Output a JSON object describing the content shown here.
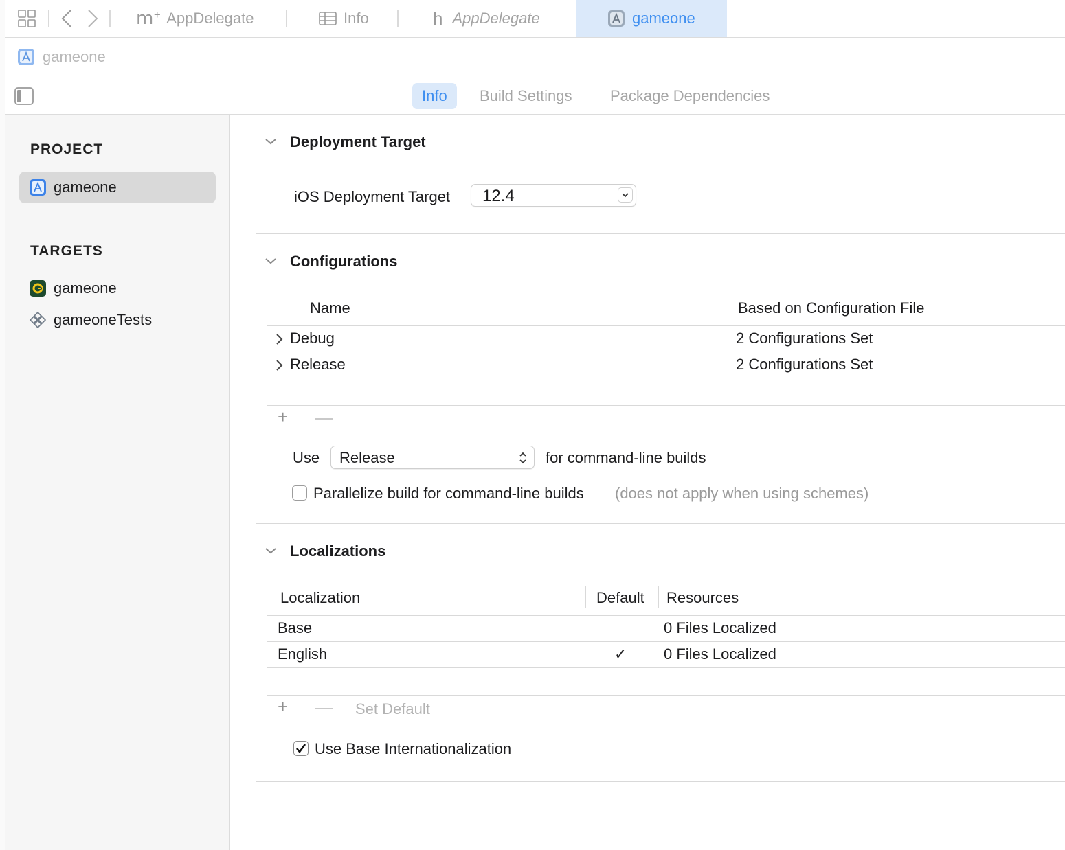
{
  "tabs": [
    {
      "label": "AppDelegate",
      "icon": "objc-file-icon"
    },
    {
      "label": "Info",
      "icon": "table-icon"
    },
    {
      "label": "AppDelegate",
      "icon": "header-file-icon"
    },
    {
      "label": "gameone",
      "icon": "xcodeproj-icon"
    }
  ],
  "breadcrumb": {
    "label": "gameone"
  },
  "segments": [
    "Info",
    "Build Settings",
    "Package Dependencies"
  ],
  "sidebar": {
    "project_header": "PROJECT",
    "project_item": "gameone",
    "targets_header": "TARGETS",
    "targets": [
      "gameone",
      "gameoneTests"
    ]
  },
  "deployment": {
    "title": "Deployment Target",
    "label": "iOS Deployment Target",
    "value": "12.4"
  },
  "configurations": {
    "title": "Configurations",
    "col_name": "Name",
    "col_file": "Based on Configuration File",
    "rows": [
      {
        "name": "Debug",
        "file": "2 Configurations Set"
      },
      {
        "name": "Release",
        "file": "2 Configurations Set"
      }
    ],
    "use_prefix": "Use",
    "use_value": "Release",
    "use_suffix": "for command-line builds",
    "parallelize_label": "Parallelize build for command-line builds",
    "parallelize_note": "(does not apply when using schemes)",
    "parallelize_checked": false
  },
  "localizations": {
    "title": "Localizations",
    "col_localization": "Localization",
    "col_default": "Default",
    "col_resources": "Resources",
    "rows": [
      {
        "name": "Base",
        "default": "",
        "resources": "0 Files Localized"
      },
      {
        "name": "English",
        "default": "✓",
        "resources": "0 Files Localized"
      }
    ],
    "set_default": "Set Default",
    "base_intl_label": "Use Base Internationalization",
    "base_intl_checked": true
  },
  "colors": {
    "accent": "#3f8ff0",
    "tab_active_bg": "#dbe9fa"
  }
}
